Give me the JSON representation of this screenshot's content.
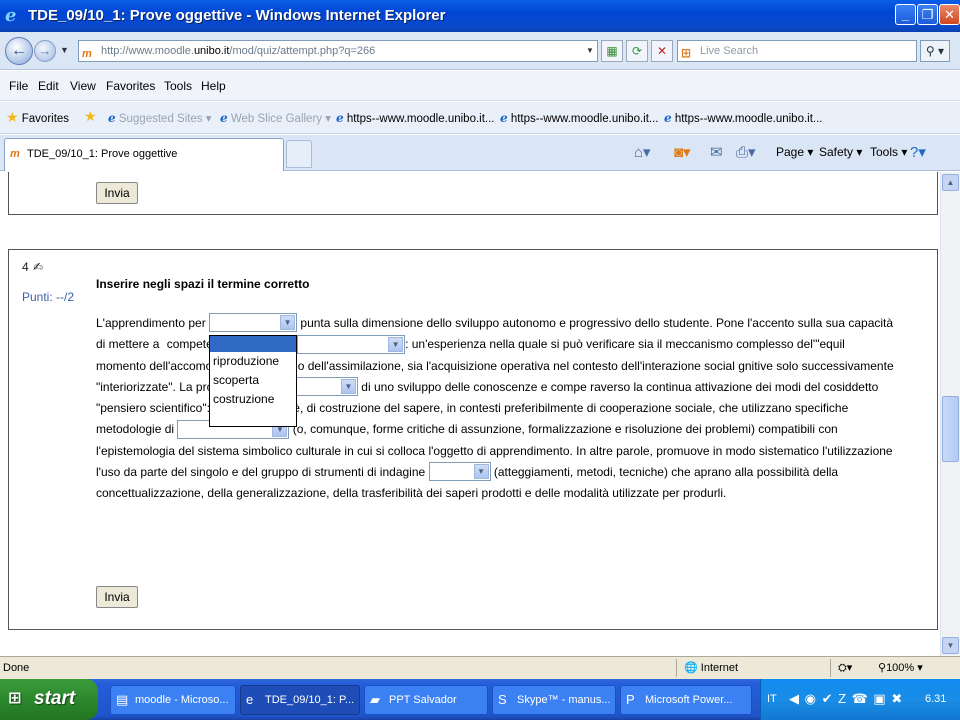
{
  "window": {
    "title": "TDE_09/10_1: Prove oggettive - Windows Internet Explorer",
    "minimize": "_",
    "maximize": "❐",
    "close": "✕"
  },
  "address_bar": {
    "url_prefix": "http://www.moodle.",
    "url_host": "unibo.it",
    "url_rest": "/mod/quiz/attempt.php?q=266",
    "search_placeholder": "Live Search"
  },
  "menu": [
    "File",
    "Edit",
    "View",
    "Favorites",
    "Tools",
    "Help"
  ],
  "favorites_bar": {
    "favorites_label": "Favorites",
    "items": [
      {
        "label": "Suggested Sites ▾",
        "dim": true
      },
      {
        "label": "Web Slice Gallery ▾",
        "dim": true
      },
      {
        "label": "https--www.moodle.unibo.it...",
        "dim": false
      },
      {
        "label": "https--www.moodle.unibo.it...",
        "dim": false
      },
      {
        "label": "https--www.moodle.unibo.it...",
        "dim": false
      }
    ]
  },
  "tab": {
    "active_label": "TDE_09/10_1: Prove oggettive"
  },
  "command_bar": {
    "page": "Page ▾",
    "safety": "Safety ▾",
    "tools": "Tools ▾"
  },
  "quiz": {
    "submit_label": "Invia",
    "question_number": "4",
    "points": "Punti: --/2",
    "heading": "Inserire negli spazi il termine corretto",
    "text": {
      "s1": "L'apprendimento per",
      "s2": "punta sulla dimensione dello sviluppo autonomo e progressivo dello studente. Pone l'accento sulla sua capacità di mettere a",
      "s2b": "competenze attraverso l'",
      "s3": ": un'esperienza nella quale si può verificare sia il meccanismo complesso del'\"equil",
      "s3b": "momento dell'accomodamento a quello dell'assimilazione, sia l'acquisizione operativa nel contesto dell'interazione social",
      "s3c": "gnitive solo successivamente \"interiorizzate\". La prospettiva",
      "s4": "di uno sviluppo delle conoscenze e compe",
      "s4b": "raverso la continua attivazione dei modi del cosiddetto \"pensiero scientifico\": di modalità, cioè, di costruzione del sapere, in contesti preferibilmente di cooperazione sociale, che utilizzano specifiche metodologie di",
      "s5": "(o, comunque, forme critiche di assunzione, formalizzazione e risoluzione dei problemi) compatibili con l'epistemologia del sistema simbolico culturale in cui si colloca l'oggetto di apprendimento. In altre parole, promuove in modo sistematico l'utilizzazione l'uso da parte del singolo e del gruppo di strumenti di indagine",
      "s6": "(atteggiamenti, metodi, tecniche) che aprano alla possibilità della concettualizzazione, della generalizzazione, della trasferibilità dei saperi prodotti e delle modalità utilizzate per produrli."
    },
    "dropdown_options": [
      "",
      "riproduzione",
      "scoperta",
      "costruzione"
    ]
  },
  "status_bar": {
    "text": "Done",
    "zone": "Internet",
    "zoom": "100%"
  },
  "taskbar": {
    "start": "start",
    "tasks": [
      {
        "label": "moodle - Microso...",
        "icon": "word-icon",
        "active": false
      },
      {
        "label": "TDE_09/10_1: P...",
        "icon": "ie-icon",
        "active": true
      },
      {
        "label": "PPT Salvador",
        "icon": "folder-icon",
        "active": false
      },
      {
        "label": "Skype™ - manus...",
        "icon": "skype-icon",
        "active": false
      },
      {
        "label": "Microsoft Power...",
        "icon": "powerpoint-icon",
        "active": false
      }
    ],
    "language": "IT",
    "clock": "6.31"
  }
}
